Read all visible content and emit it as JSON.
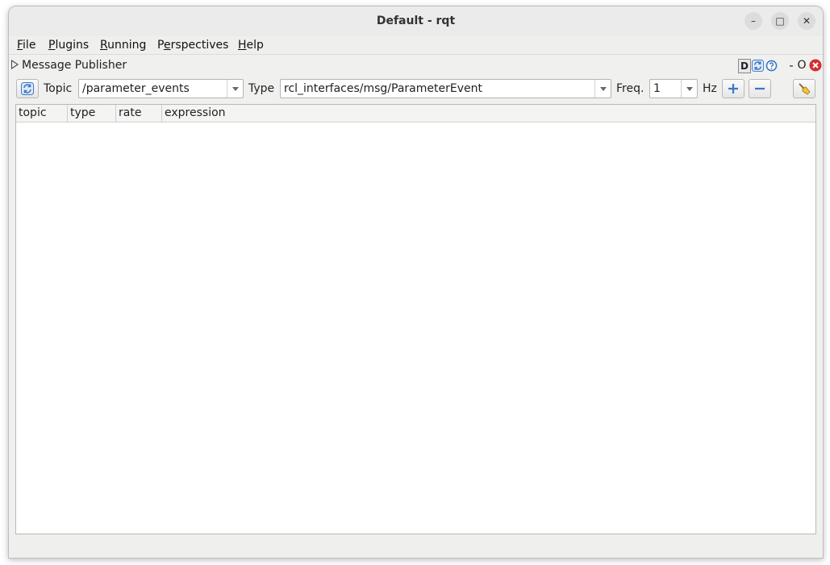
{
  "window": {
    "title": "Default - rqt",
    "controls": {
      "minimize": "–",
      "maximize": "□",
      "close": "✕"
    }
  },
  "menubar": {
    "items": [
      {
        "label_ul": "F",
        "label_rest": "ile"
      },
      {
        "label_ul": "P",
        "label_rest": "lugins"
      },
      {
        "label_ul": "R",
        "label_rest": "unning"
      },
      {
        "label_pre": "P",
        "label_ul": "e",
        "label_rest": "rspectives"
      },
      {
        "label_ul": "H",
        "label_rest": "elp"
      }
    ]
  },
  "plugin": {
    "title": "Message Publisher",
    "tools": {
      "d": "D",
      "minus": "-",
      "o": "O"
    }
  },
  "toolbar": {
    "topic_label": "Topic",
    "topic_value": "/parameter_events",
    "type_label": "Type",
    "type_value": "rcl_interfaces/msg/ParameterEvent",
    "freq_label": "Freq.",
    "freq_value": "1",
    "hz_label": "Hz"
  },
  "table": {
    "columns": [
      "topic",
      "type",
      "rate",
      "expression"
    ],
    "rows": []
  },
  "icons": {
    "refresh": "refresh-icon",
    "add": "plus-icon",
    "remove": "minus-icon",
    "clear": "broom-icon",
    "help": "help-icon",
    "reload": "reload-icon",
    "close_plugin": "close-icon"
  },
  "colors": {
    "accent_blue": "#3b78c4",
    "close_red": "#d32f2f"
  }
}
